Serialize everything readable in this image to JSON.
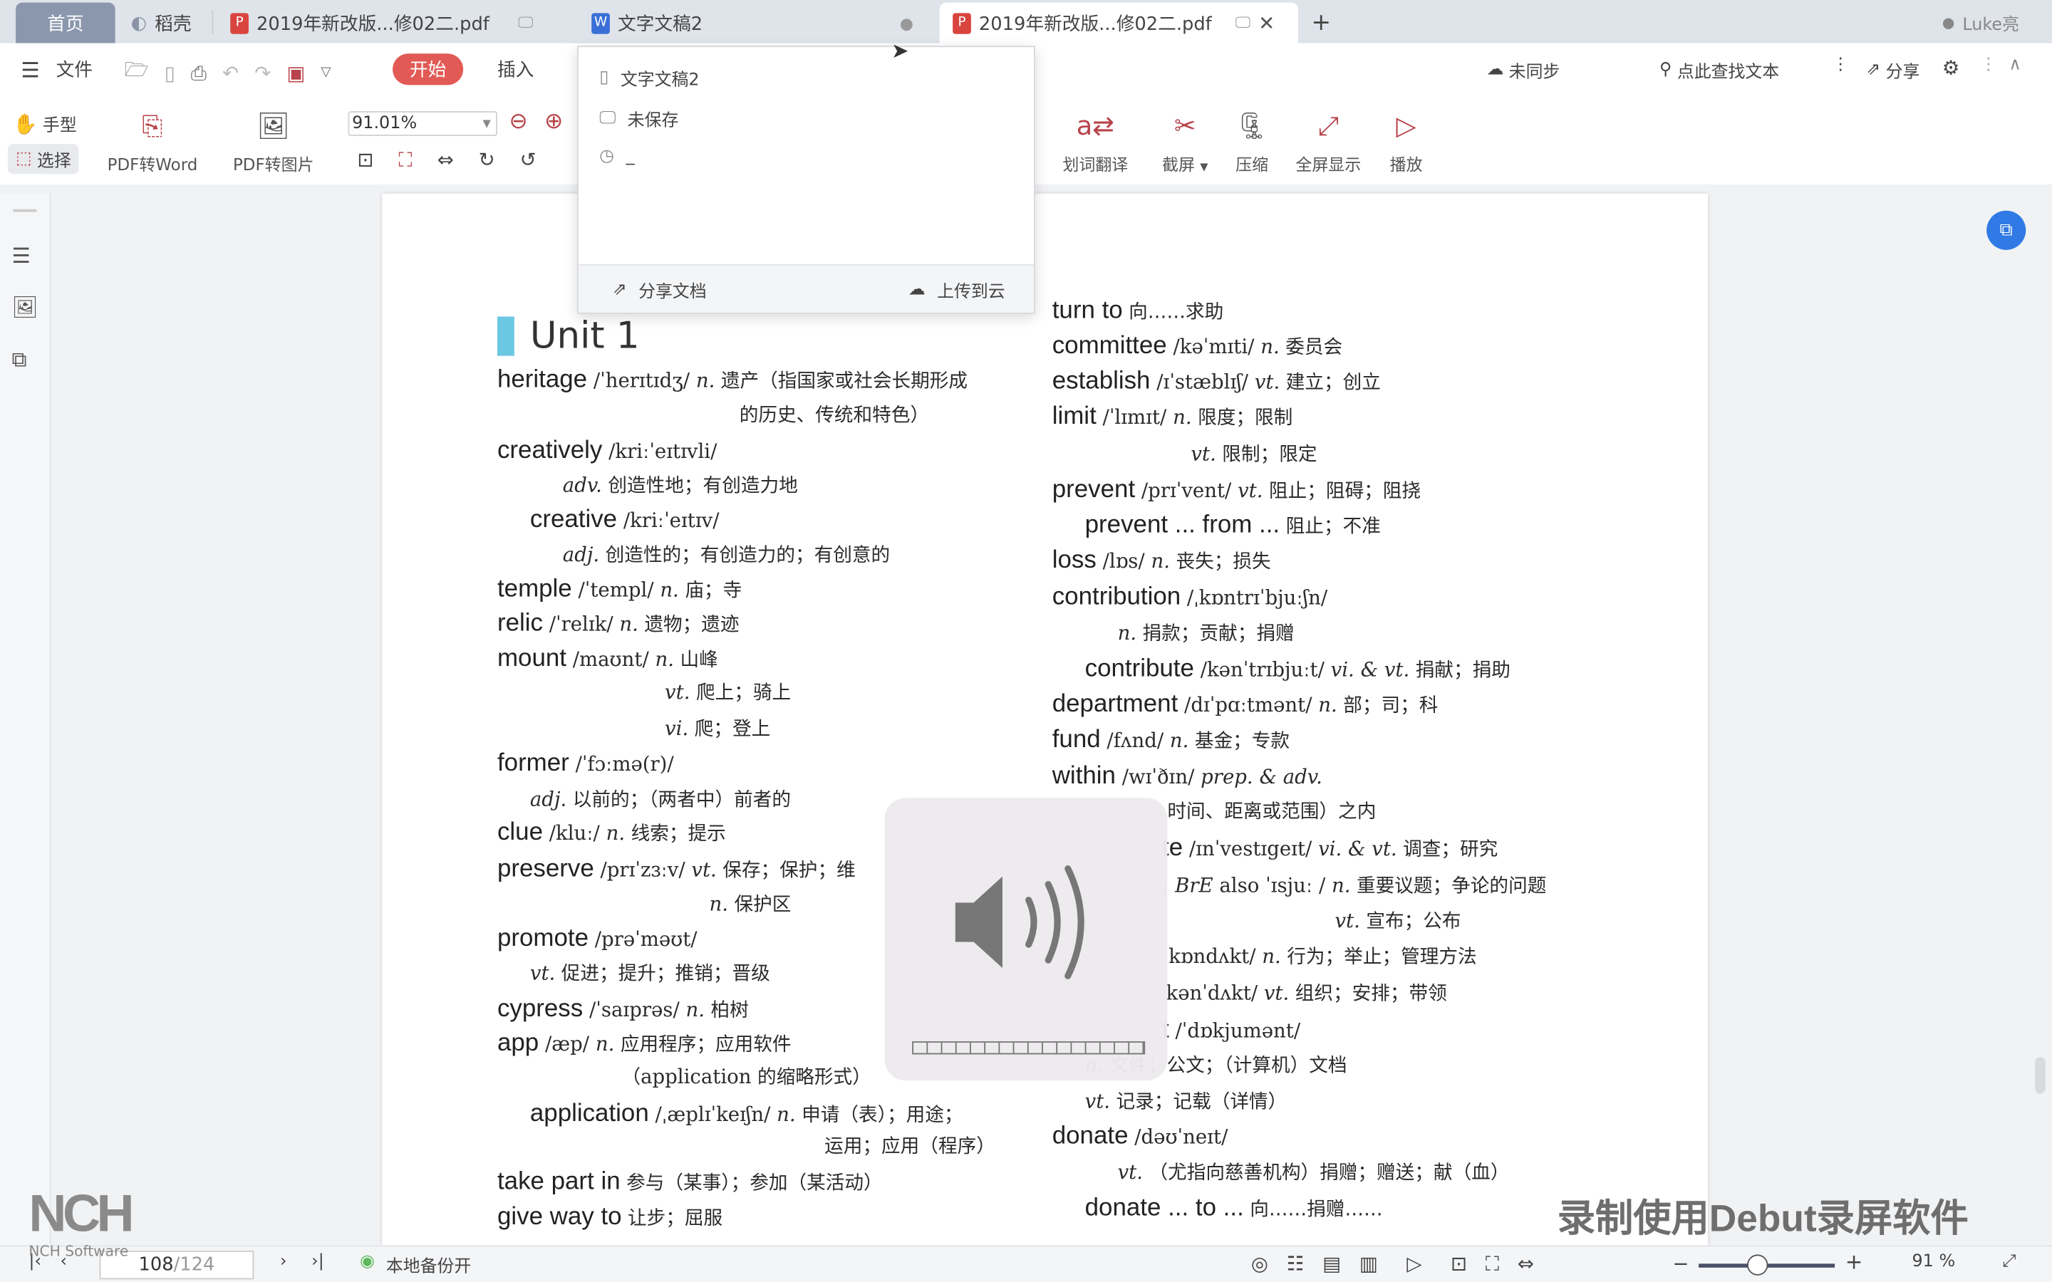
{
  "tabs": [
    {
      "label": "首页"
    },
    {
      "label": "稻壳"
    },
    {
      "label": "2019年新改版...修02二.pdf"
    },
    {
      "label": "文字文稿2"
    },
    {
      "label": "2019年新改版...修02二.pdf"
    }
  ],
  "user": "Luke亮",
  "menu": {
    "file": "文件",
    "start": "开始",
    "insert": "插入",
    "sync": "未同步",
    "search": "点此查找文本",
    "share": "分享"
  },
  "ribbon": {
    "hand": "手型",
    "select": "选择",
    "pdf_to_word": "PDF转Word",
    "pdf_to_image": "PDF转图片",
    "zoom_value": "91.01%",
    "translate": "划词翻译",
    "screenshot": "截屏",
    "compress": "压缩",
    "fullscreen": "全屏显示",
    "play": "播放"
  },
  "popup": {
    "doc_name": "文字文稿2",
    "save_status": "未保存",
    "time": "_",
    "share": "分享文档",
    "upload": "上传到云"
  },
  "page": {
    "unit_title": "Unit 1",
    "left": [
      [
        [
          "w",
          "heritage"
        ],
        [
          "p",
          " /ˈherɪtɪdʒ/ "
        ],
        [
          "i",
          "n."
        ],
        [
          "z",
          " 遗产（指国家或社会长期形成"
        ]
      ],
      [
        [
          "z",
          "的历史、传统和特色）"
        ]
      ],
      [
        [
          "w",
          "creatively"
        ],
        [
          "p",
          " /kriːˈeɪtɪvli/"
        ]
      ],
      [
        [
          "i",
          "adv."
        ],
        [
          "z",
          " 创造性地；有创造力地"
        ]
      ],
      [
        [
          "w",
          "creative"
        ],
        [
          "p",
          " /kriːˈeɪtɪv/"
        ]
      ],
      [
        [
          "i",
          "adj."
        ],
        [
          "z",
          " 创造性的；有创造力的；有创意的"
        ]
      ],
      [
        [
          "w",
          "temple"
        ],
        [
          "p",
          " /ˈtempl/ "
        ],
        [
          "i",
          "n."
        ],
        [
          "z",
          " 庙；寺"
        ]
      ],
      [
        [
          "w",
          "relic"
        ],
        [
          "p",
          " /ˈrelɪk/ "
        ],
        [
          "i",
          "n."
        ],
        [
          "z",
          " 遗物；遗迹"
        ]
      ],
      [
        [
          "w",
          "mount"
        ],
        [
          "p",
          " /maʊnt/ "
        ],
        [
          "i",
          "n."
        ],
        [
          "z",
          " 山峰"
        ]
      ],
      [
        [
          "i",
          "vt."
        ],
        [
          "z",
          " 爬上；骑上"
        ]
      ],
      [
        [
          "i",
          "vi."
        ],
        [
          "z",
          " 爬；登上"
        ]
      ],
      [
        [
          "w",
          "former"
        ],
        [
          "p",
          " /ˈfɔːmə(r)/"
        ]
      ],
      [
        [
          "i",
          "adj."
        ],
        [
          "z",
          " 以前的；（两者中）前者的"
        ]
      ],
      [
        [
          "w",
          "clue"
        ],
        [
          "p",
          " /kluː/ "
        ],
        [
          "i",
          "n."
        ],
        [
          "z",
          " 线索；提示"
        ]
      ],
      [
        [
          "w",
          "preserve"
        ],
        [
          "p",
          " /prɪˈzɜːv/ "
        ],
        [
          "i",
          "vt."
        ],
        [
          "z",
          " 保存；保护；维"
        ]
      ],
      [
        [
          "i",
          "n."
        ],
        [
          "z",
          " 保护区"
        ]
      ],
      [
        [
          "w",
          "promote"
        ],
        [
          "p",
          " /prəˈməʊt/"
        ]
      ],
      [
        [
          "i",
          "vt."
        ],
        [
          "z",
          " 促进；提升；推销；晋级"
        ]
      ],
      [
        [
          "w",
          "cypress"
        ],
        [
          "p",
          " /ˈsaɪprəs/ "
        ],
        [
          "i",
          "n."
        ],
        [
          "z",
          " 柏树"
        ]
      ],
      [
        [
          "w",
          "app"
        ],
        [
          "p",
          " /æp/ "
        ],
        [
          "i",
          "n."
        ],
        [
          "z",
          " 应用程序；应用软件"
        ]
      ],
      [
        [
          "z",
          "（"
        ],
        [
          "p",
          "application"
        ],
        [
          "z",
          " 的缩略形式）"
        ]
      ],
      [
        [
          "w",
          "application"
        ],
        [
          "p",
          " /ˌæplɪˈkeɪʃn/ "
        ],
        [
          "i",
          "n."
        ],
        [
          "z",
          " 申请（表）；用途；"
        ]
      ],
      [
        [
          "z",
          "运用；应用（程序）"
        ]
      ],
      [
        [
          "w",
          "take part in"
        ],
        [
          "z",
          " 参与（某事）；参加（某活动）"
        ]
      ],
      [
        [
          "w",
          "give way to"
        ],
        [
          "z",
          " 让步；屈服"
        ]
      ]
    ],
    "right": [
      [
        [
          "w",
          "turn to"
        ],
        [
          "z",
          " 向……求助"
        ]
      ],
      [
        [
          "w",
          "committee"
        ],
        [
          "p",
          " /kəˈmɪti/ "
        ],
        [
          "i",
          "n."
        ],
        [
          "z",
          " 委员会"
        ]
      ],
      [
        [
          "w",
          "establish"
        ],
        [
          "p",
          " /ɪˈstæblɪʃ/ "
        ],
        [
          "i",
          "vt."
        ],
        [
          "z",
          " 建立；创立"
        ]
      ],
      [
        [
          "w",
          "limit"
        ],
        [
          "p",
          " /ˈlɪmɪt/ "
        ],
        [
          "i",
          "n."
        ],
        [
          "z",
          " 限度；限制"
        ]
      ],
      [
        [
          "i",
          "vt."
        ],
        [
          "z",
          " 限制；限定"
        ]
      ],
      [
        [
          "w",
          "prevent"
        ],
        [
          "p",
          " /prɪˈvent/ "
        ],
        [
          "i",
          "vt."
        ],
        [
          "z",
          " 阻止；阻碍；阻挠"
        ]
      ],
      [
        [
          "w",
          "prevent ... from ..."
        ],
        [
          "z",
          " 阻止；不准"
        ]
      ],
      [
        [
          "w",
          "loss"
        ],
        [
          "p",
          " /lɒs/ "
        ],
        [
          "i",
          "n."
        ],
        [
          "z",
          " 丧失；损失"
        ]
      ],
      [
        [
          "w",
          "contribution"
        ],
        [
          "p",
          " /ˌkɒntrɪˈbjuːʃn/"
        ]
      ],
      [
        [
          "i",
          "n."
        ],
        [
          "z",
          " 捐款；贡献；捐赠"
        ]
      ],
      [
        [
          "w",
          "contribute"
        ],
        [
          "p",
          " /kənˈtrɪbjuːt/ "
        ],
        [
          "i",
          "vi. & vt."
        ],
        [
          "z",
          " 捐献；捐助"
        ]
      ],
      [
        [
          "w",
          "department"
        ],
        [
          "p",
          " /dɪˈpɑːtmənt/ "
        ],
        [
          "i",
          "n."
        ],
        [
          "z",
          " 部；司；科"
        ]
      ],
      [
        [
          "w",
          "fund"
        ],
        [
          "p",
          " /fʌnd/ "
        ],
        [
          "i",
          "n."
        ],
        [
          "z",
          " 基金；专款"
        ]
      ],
      [
        [
          "w",
          "within"
        ],
        [
          "p",
          " /wɪˈðɪn/ "
        ],
        [
          "i",
          "prep. & adv."
        ]
      ],
      [
        [
          "z",
          "时间、距离或范围）之内"
        ]
      ],
      [
        [
          "w",
          "te"
        ],
        [
          "p",
          " /ɪnˈvestɪgeɪt/ "
        ],
        [
          "i",
          "vi. & vt."
        ],
        [
          "z",
          " 调查；研究"
        ]
      ],
      [
        [
          "p",
          "; "
        ],
        [
          "i",
          "BrE"
        ],
        [
          "p",
          " also ˈɪsjuː / "
        ],
        [
          "i",
          "n."
        ],
        [
          "z",
          " 重要议题；争论的问题"
        ]
      ],
      [
        [
          "i",
          "vt."
        ],
        [
          "z",
          " 宣布；公布"
        ]
      ],
      [
        [
          "p",
          "kɒndʌkt/ "
        ],
        [
          "i",
          "n."
        ],
        [
          "z",
          " 行为；举止；管理方法"
        ]
      ],
      [
        [
          "p",
          "kənˈdʌkt/ "
        ],
        [
          "i",
          "vt."
        ],
        [
          "z",
          " 组织；安排；带领"
        ]
      ],
      [
        [
          "w",
          "t"
        ],
        [
          "p",
          " /ˈdɒkjumənt/"
        ]
      ],
      [
        [
          "i",
          "n."
        ],
        [
          "z",
          " 文件；公文；（计算机）文档"
        ]
      ],
      [
        [
          "i",
          "vt."
        ],
        [
          "z",
          " 记录；记载（详情）"
        ]
      ],
      [
        [
          "w",
          "donate"
        ],
        [
          "p",
          " /dəʊˈneɪt/"
        ]
      ],
      [
        [
          "i",
          "vt."
        ],
        [
          "z",
          " （尤指向慈善机构）捐赠；赠送；献（血）"
        ]
      ],
      [
        [
          "w",
          "donate ... to ..."
        ],
        [
          "z",
          " 向……捐赠……"
        ]
      ]
    ]
  },
  "status": {
    "current_page": "108",
    "total_pages": "/124",
    "backup": "本地备份开",
    "zoom": "91 %",
    "zoom_level": 91
  },
  "volume": {
    "level": 0,
    "segments": 16
  },
  "watermark": "录制使用Debut录屏软件",
  "logo": {
    "text": "NCH",
    "sub": "NCH Software"
  },
  "colors": {
    "accent": "#e25a55",
    "home_tab": "#8b97ad",
    "icon_red": "#b8434a",
    "unit_bar": "#6cc7e2",
    "float_button": "#2f7ae5"
  }
}
